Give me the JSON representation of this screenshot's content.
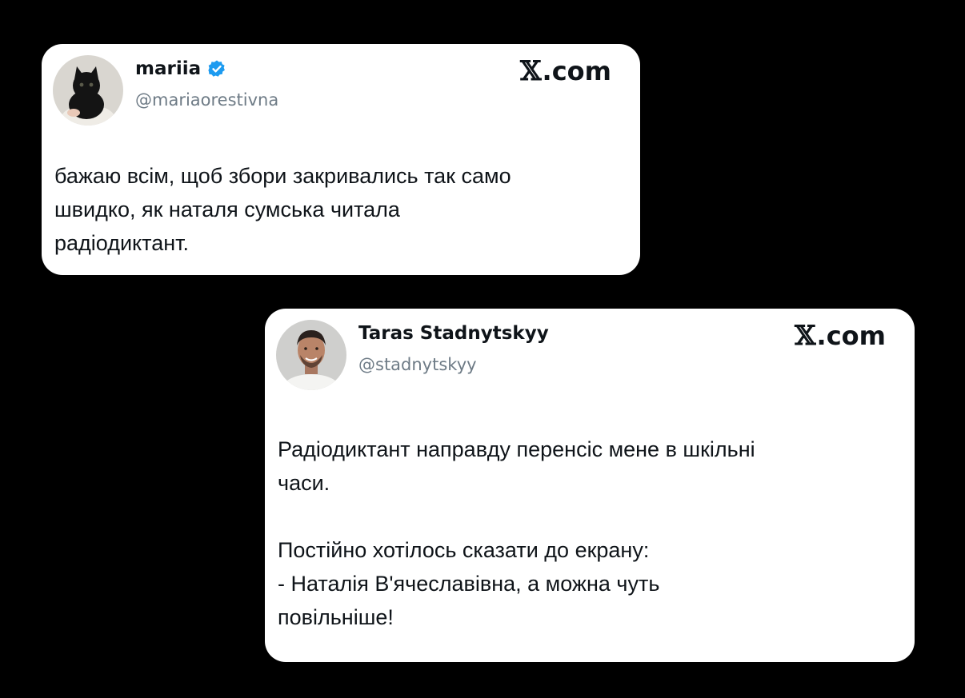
{
  "tweets": [
    {
      "display_name": "mariia",
      "handle": "@mariaorestivna",
      "verified": true,
      "brand": ".com",
      "text": "бажаю всім, щоб збори закривались так само\nшвидко, як наталя сумська читала\nрадіодиктант."
    },
    {
      "display_name": "Taras Stadnytskyy",
      "handle": "@stadnytskyy",
      "verified": false,
      "brand": ".com",
      "text": "Радіодиктант направду перенсіс мене в шкільні\nчаси.\n\nПостійно хотілось сказати до екрану:\n- Наталія В'ячеславівна, а можна чуть\nповільніше!"
    }
  ],
  "colors": {
    "background": "#000000",
    "card": "#ffffff",
    "text": "#0f1419",
    "muted": "#6e7b86",
    "verified_badge": "#1d9bf0"
  },
  "icons": {
    "avatar_1": "black-kitten-avatar",
    "avatar_2": "man-portrait-avatar",
    "verified": "verified-badge-icon",
    "brand": "x-logo-icon"
  }
}
